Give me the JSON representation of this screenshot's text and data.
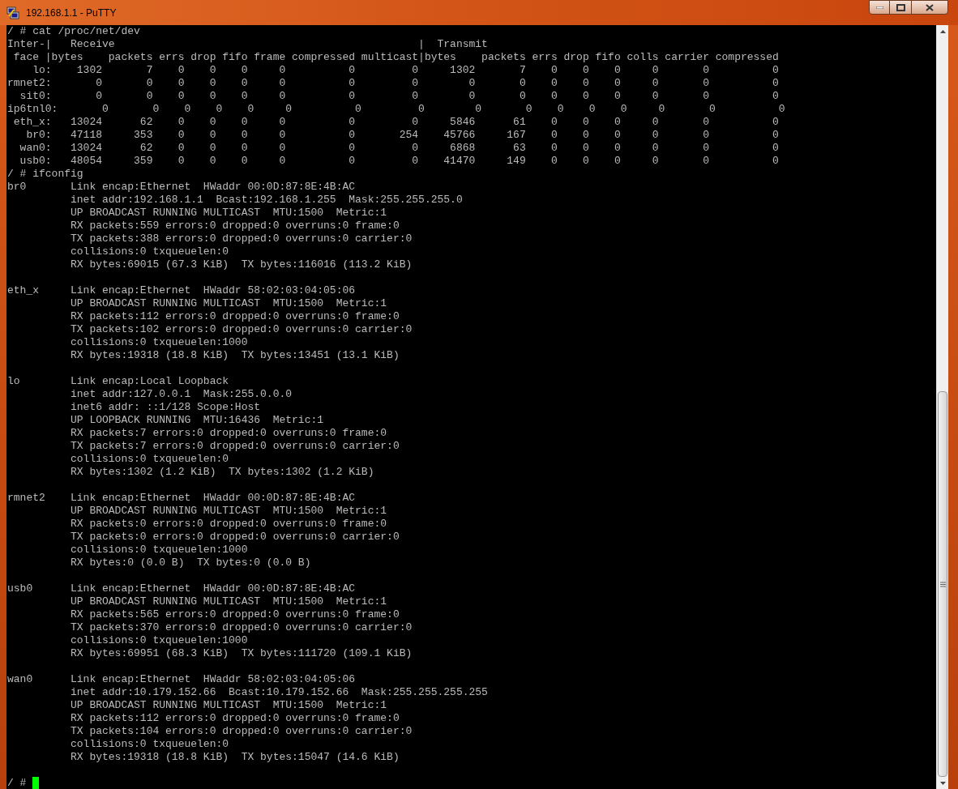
{
  "window": {
    "title": "192.168.1.1 - PuTTY"
  },
  "terminal": {
    "blocks": [
      {
        "lines": [
          "/ # cat /proc/net/dev",
          "Inter-|   Receive                                                |  Transmit",
          " face |bytes    packets errs drop fifo frame compressed multicast|bytes    packets errs drop fifo colls carrier compressed",
          "    lo:    1302       7    0    0    0     0          0         0     1302       7    0    0    0     0       0          0",
          "rmnet2:       0       0    0    0    0     0          0         0        0       0    0    0    0     0       0          0",
          "  sit0:       0       0    0    0    0     0          0         0        0       0    0    0    0     0       0          0",
          "ip6tnl0:       0       0    0    0    0     0          0         0        0       0    0    0    0     0       0          0",
          " eth_x:   13024      62    0    0    0     0          0         0     5846      61    0    0    0     0       0          0",
          "   br0:   47118     353    0    0    0     0          0       254    45766     167    0    0    0     0       0          0",
          "  wan0:   13024      62    0    0    0     0          0         0     6868      63    0    0    0     0       0          0",
          "  usb0:   48054     359    0    0    0     0          0         0    41470     149    0    0    0     0       0          0",
          "/ # ifconfig",
          "br0       Link encap:Ethernet  HWaddr 00:0D:87:8E:4B:AC",
          "          inet addr:192.168.1.1  Bcast:192.168.1.255  Mask:255.255.255.0",
          "          UP BROADCAST RUNNING MULTICAST  MTU:1500  Metric:1",
          "          RX packets:559 errors:0 dropped:0 overruns:0 frame:0",
          "          TX packets:388 errors:0 dropped:0 overruns:0 carrier:0",
          "          collisions:0 txqueuelen:0",
          "          RX bytes:69015 (67.3 KiB)  TX bytes:116016 (113.2 KiB)"
        ]
      },
      {
        "lines": [
          "eth_x     Link encap:Ethernet  HWaddr 58:02:03:04:05:06",
          "          UP BROADCAST RUNNING MULTICAST  MTU:1500  Metric:1",
          "          RX packets:112 errors:0 dropped:0 overruns:0 frame:0",
          "          TX packets:102 errors:0 dropped:0 overruns:0 carrier:0",
          "          collisions:0 txqueuelen:1000",
          "          RX bytes:19318 (18.8 KiB)  TX bytes:13451 (13.1 KiB)"
        ]
      },
      {
        "lines": [
          "lo        Link encap:Local Loopback",
          "          inet addr:127.0.0.1  Mask:255.0.0.0",
          "          inet6 addr: ::1/128 Scope:Host",
          "          UP LOOPBACK RUNNING  MTU:16436  Metric:1",
          "          RX packets:7 errors:0 dropped:0 overruns:0 frame:0",
          "          TX packets:7 errors:0 dropped:0 overruns:0 carrier:0",
          "          collisions:0 txqueuelen:0",
          "          RX bytes:1302 (1.2 KiB)  TX bytes:1302 (1.2 KiB)"
        ]
      },
      {
        "lines": [
          "rmnet2    Link encap:Ethernet  HWaddr 00:0D:87:8E:4B:AC",
          "          UP BROADCAST RUNNING MULTICAST  MTU:1500  Metric:1",
          "          RX packets:0 errors:0 dropped:0 overruns:0 frame:0",
          "          TX packets:0 errors:0 dropped:0 overruns:0 carrier:0",
          "          collisions:0 txqueuelen:1000",
          "          RX bytes:0 (0.0 B)  TX bytes:0 (0.0 B)"
        ]
      },
      {
        "lines": [
          "usb0      Link encap:Ethernet  HWaddr 00:0D:87:8E:4B:AC",
          "          UP BROADCAST RUNNING MULTICAST  MTU:1500  Metric:1",
          "          RX packets:565 errors:0 dropped:0 overruns:0 frame:0",
          "          TX packets:370 errors:0 dropped:0 overruns:0 carrier:0",
          "          collisions:0 txqueuelen:1000",
          "          RX bytes:69951 (68.3 KiB)  TX bytes:111720 (109.1 KiB)"
        ]
      },
      {
        "lines": [
          "wan0      Link encap:Ethernet  HWaddr 58:02:03:04:05:06",
          "          inet addr:10.179.152.66  Bcast:10.179.152.66  Mask:255.255.255.255",
          "          UP BROADCAST RUNNING MULTICAST  MTU:1500  Metric:1",
          "          RX packets:112 errors:0 dropped:0 overruns:0 frame:0",
          "          TX packets:104 errors:0 dropped:0 overruns:0 carrier:0",
          "          collisions:0 txqueuelen:0",
          "          RX bytes:19318 (18.8 KiB)  TX bytes:15047 (14.6 KiB)"
        ]
      }
    ],
    "prompt": "/ # "
  }
}
